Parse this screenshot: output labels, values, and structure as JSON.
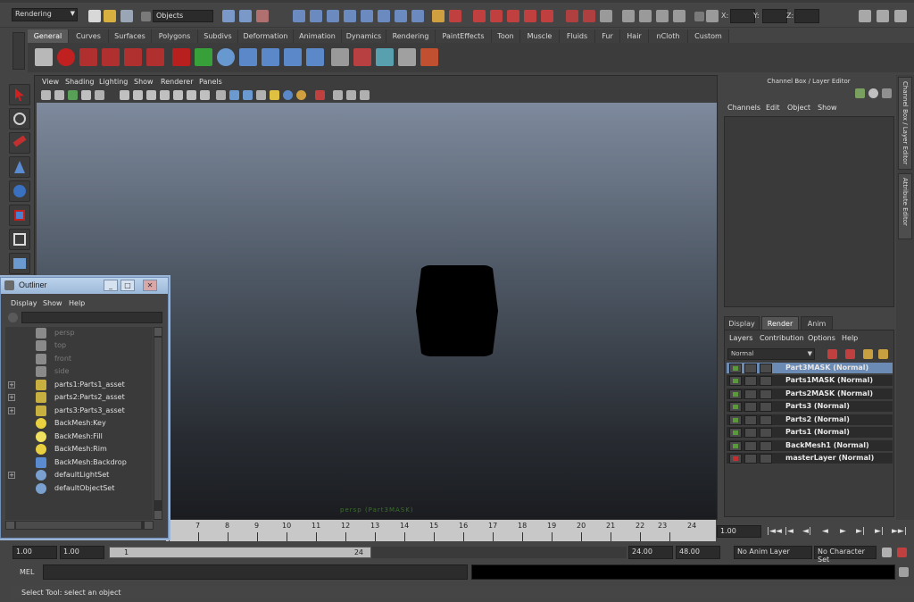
{
  "statusline": {
    "mode": "Rendering",
    "object_field": "Objects",
    "coords": [
      "X:",
      "Y:",
      "Z:"
    ]
  },
  "shelf": {
    "tabs": [
      "General",
      "Curves",
      "Surfaces",
      "Polygons",
      "Subdivs",
      "Deformation",
      "Animation",
      "Dynamics",
      "Rendering",
      "PaintEffects",
      "Toon",
      "Muscle",
      "Fluids",
      "Fur",
      "Hair",
      "nCloth",
      "Custom"
    ],
    "active_tab": "General"
  },
  "panel": {
    "menus": [
      "View",
      "Shading",
      "Lighting",
      "Show",
      "Renderer",
      "Panels"
    ],
    "camera_label": "persp (Part3MASK)"
  },
  "channel_box": {
    "title": "Channel Box / Layer Editor",
    "menus": [
      "Channels",
      "Edit",
      "Object",
      "Show"
    ],
    "layer_tabs": [
      "Display",
      "Render",
      "Anim"
    ],
    "active_layer_tab": "Render",
    "layer_menus": [
      "Layers",
      "Contribution",
      "Options",
      "Help"
    ],
    "blend_mode": "Normal",
    "layers": [
      {
        "name": "Part3MASK (Normal)",
        "selected": true
      },
      {
        "name": "Parts1MASK (Normal)",
        "selected": false
      },
      {
        "name": "Parts2MASK (Normal)",
        "selected": false
      },
      {
        "name": "Parts3 (Normal)",
        "selected": false
      },
      {
        "name": "Parts2 (Normal)",
        "selected": false
      },
      {
        "name": "Parts1 (Normal)",
        "selected": false
      },
      {
        "name": "BackMesh1 (Normal)",
        "selected": false
      },
      {
        "name": "masterLayer (Normal)",
        "selected": false
      }
    ]
  },
  "side_tabs": [
    "Channel Box / Layer Editor",
    "Attribute Editor"
  ],
  "time_slider": {
    "ticks": [
      "7",
      "8",
      "9",
      "10",
      "11",
      "12",
      "13",
      "14",
      "15",
      "16",
      "17",
      "18",
      "19",
      "20",
      "21",
      "22",
      "23",
      "24"
    ],
    "current_frame": "1.00",
    "playback_buttons": [
      "|◄◄",
      "|◄",
      "◄|",
      "◄",
      "►",
      "►|",
      "►|",
      "►►|"
    ]
  },
  "range_slider": {
    "start_time": "1.00",
    "playback_start": "1.00",
    "range_start_label": "1",
    "range_end_label": "24",
    "playback_end": "24.00",
    "end_time": "48.00",
    "anim_layer": "No Anim Layer",
    "character_set": "No Character Set"
  },
  "command_line": {
    "label": "MEL"
  },
  "help_line": "Select Tool: select an object",
  "outliner": {
    "title": "Outliner",
    "menus": [
      "Display",
      "Show",
      "Help"
    ],
    "items": [
      {
        "label": "persp",
        "dim": true,
        "expandable": false,
        "color": "#8a8a8a"
      },
      {
        "label": "top",
        "dim": true,
        "expandable": false,
        "color": "#8a8a8a"
      },
      {
        "label": "front",
        "dim": true,
        "expandable": false,
        "color": "#8a8a8a"
      },
      {
        "label": "side",
        "dim": true,
        "expandable": false,
        "color": "#8a8a8a"
      },
      {
        "label": "parts1:Parts1_asset",
        "dim": false,
        "expandable": true,
        "color": "#c8b040"
      },
      {
        "label": "parts2:Parts2_asset",
        "dim": false,
        "expandable": true,
        "color": "#c8b040"
      },
      {
        "label": "parts3:Parts3_asset",
        "dim": false,
        "expandable": true,
        "color": "#c8b040"
      },
      {
        "label": "BackMesh:Key",
        "dim": false,
        "expandable": false,
        "color": "#e8d040"
      },
      {
        "label": "BackMesh:Fill",
        "dim": false,
        "expandable": false,
        "color": "#f0e060"
      },
      {
        "label": "BackMesh:Rim",
        "dim": false,
        "expandable": false,
        "color": "#e8d040"
      },
      {
        "label": "BackMesh:Backdrop",
        "dim": false,
        "expandable": false,
        "color": "#5a8ad0"
      },
      {
        "label": "defaultLightSet",
        "dim": false,
        "expandable": true,
        "color": "#7aa0d0"
      },
      {
        "label": "defaultObjectSet",
        "dim": false,
        "expandable": false,
        "color": "#7aa0d0"
      }
    ]
  },
  "colors": {
    "selection": "#6b8bb5",
    "ui_background": "#444444",
    "viewport_top": "#7e8a9d",
    "viewport_bottom": "#1a1c20",
    "time_slider": "#c8c8c8"
  },
  "icons": {
    "statusline": [
      "new-scene-icon",
      "open-scene-icon",
      "save-scene-icon",
      "select-by-hierarchy-icon",
      "select-by-object-icon",
      "snap-grid-icon",
      "snap-curve-icon",
      "snap-point-icon",
      "history-icon",
      "render-icon",
      "ipr-render-icon",
      "render-settings-icon",
      "hypershade-icon"
    ],
    "shelf": [
      "camera-icon",
      "help-icon",
      "render-view-icon",
      "render-icon",
      "ipr-icon",
      "batch-render-icon",
      "light-icon",
      "cone-light-icon",
      "sphere-icon",
      "spot-light-icon",
      "point-light-icon",
      "directional-light-icon",
      "area-light-icon",
      "hypershade-icon",
      "render-layer-icon",
      "material-icon",
      "texture-icon",
      "paint-icon"
    ],
    "tools": [
      "select-tool-icon",
      "lasso-tool-icon",
      "paint-select-tool-icon",
      "move-tool-icon",
      "rotate-tool-icon",
      "scale-tool-icon",
      "manipulator-tool-icon",
      "last-tool-icon"
    ]
  }
}
